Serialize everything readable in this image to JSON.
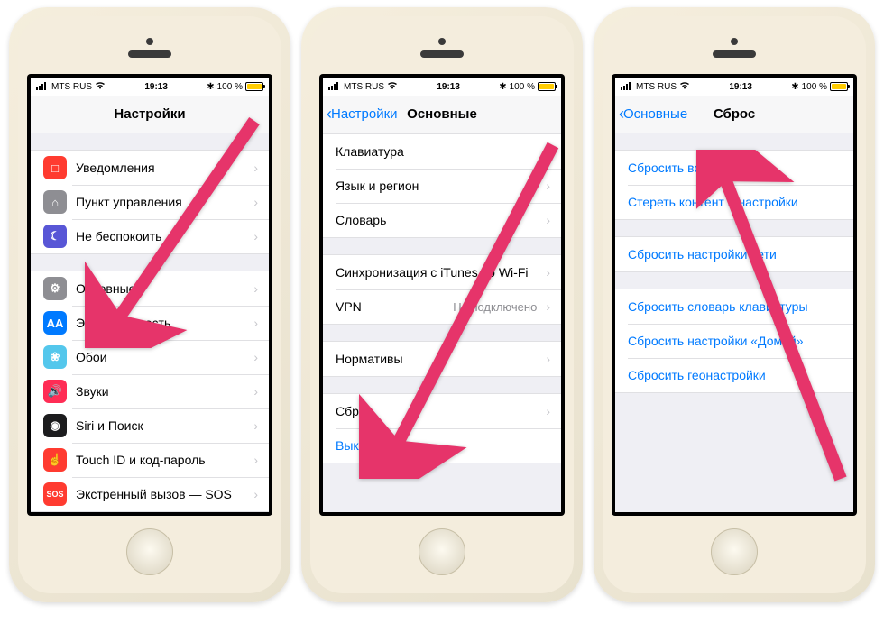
{
  "status": {
    "carrier": "MTS RUS",
    "time": "19:13",
    "battery": "100 %"
  },
  "colors": {
    "link": "#007aff",
    "arrow": "#e6346a",
    "battery": "#ffcc00"
  },
  "phone1": {
    "title": "Настройки",
    "groups": [
      [
        {
          "icon_bg": "#ff3b30",
          "icon_glyph": "□",
          "label": "Уведомления"
        },
        {
          "icon_bg": "#8e8e93",
          "icon_glyph": "⌂",
          "label": "Пункт управления"
        },
        {
          "icon_bg": "#5856d6",
          "icon_glyph": "☾",
          "label": "Не беспокоить"
        }
      ],
      [
        {
          "icon_bg": "#8e8e93",
          "icon_glyph": "⚙",
          "label": "Основные"
        },
        {
          "icon_bg": "#007aff",
          "icon_glyph": "AA",
          "label": "Экран и яркость"
        },
        {
          "icon_bg": "#54c7ec",
          "icon_glyph": "❀",
          "label": "Обои"
        },
        {
          "icon_bg": "#ff2d55",
          "icon_glyph": "🔊",
          "label": "Звуки"
        },
        {
          "icon_bg": "#1c1c1e",
          "icon_glyph": "◉",
          "label": "Siri и Поиск"
        },
        {
          "icon_bg": "#ff3b30",
          "icon_glyph": "☝",
          "label": "Touch ID и код-пароль"
        },
        {
          "icon_bg": "#ff3b30",
          "icon_glyph": "SOS",
          "label": "Экстренный вызов — SOS"
        }
      ]
    ]
  },
  "phone2": {
    "back": "Настройки",
    "title": "Основные",
    "groups": [
      [
        {
          "label": "Клавиатура"
        },
        {
          "label": "Язык и регион"
        },
        {
          "label": "Словарь"
        }
      ],
      [
        {
          "label": "Синхронизация с iTunes по Wi-Fi"
        },
        {
          "label": "VPN",
          "detail": "Не подключено"
        }
      ],
      [
        {
          "label": "Нормативы"
        }
      ],
      [
        {
          "label": "Сброс"
        },
        {
          "label": "Выключить",
          "blue": true,
          "no_chevron": true
        }
      ]
    ]
  },
  "phone3": {
    "back": "Основные",
    "title": "Сброс",
    "groups": [
      [
        {
          "label": "Сбросить все настройки",
          "blue": true
        },
        {
          "label": "Стереть контент и настройки",
          "blue": true
        }
      ],
      [
        {
          "label": "Сбросить настройки сети",
          "blue": true
        }
      ],
      [
        {
          "label": "Сбросить словарь клавиатуры",
          "blue": true
        },
        {
          "label": "Сбросить настройки «Домой»",
          "blue": true
        },
        {
          "label": "Сбросить геонастройки",
          "blue": true
        }
      ]
    ]
  }
}
